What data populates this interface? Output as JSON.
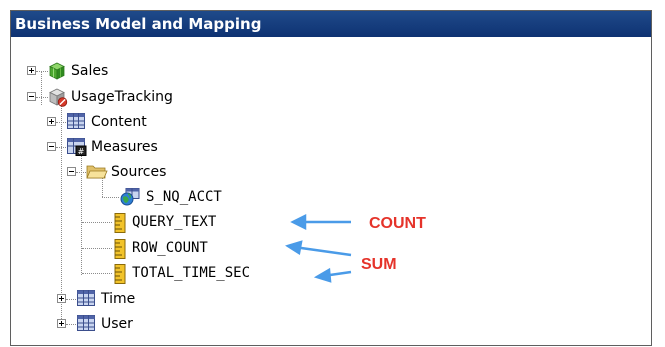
{
  "panel": {
    "title": "Business Model and Mapping"
  },
  "tree": {
    "sales": "Sales",
    "usage": "UsageTracking",
    "content": "Content",
    "measures": "Measures",
    "sources": "Sources",
    "acct": "S_NQ_ACCT",
    "query_text": "QUERY_TEXT",
    "row_count": "ROW_COUNT",
    "total_time": "TOTAL_TIME_SEC",
    "time": "Time",
    "user": "User"
  },
  "annotations": {
    "count": "COUNT",
    "sum": "SUM"
  },
  "colors": {
    "titlebar": "#0e3272",
    "annotation": "#e5332a",
    "arrow": "#4a9be8"
  },
  "icons": {
    "sales": "green-cube-icon",
    "usage": "disabled-cube-icon",
    "table": "table-icon",
    "measures": "measures-table-icon",
    "folder": "folder-icon",
    "source": "source-globe-icon",
    "measure": "ruler-icon"
  }
}
